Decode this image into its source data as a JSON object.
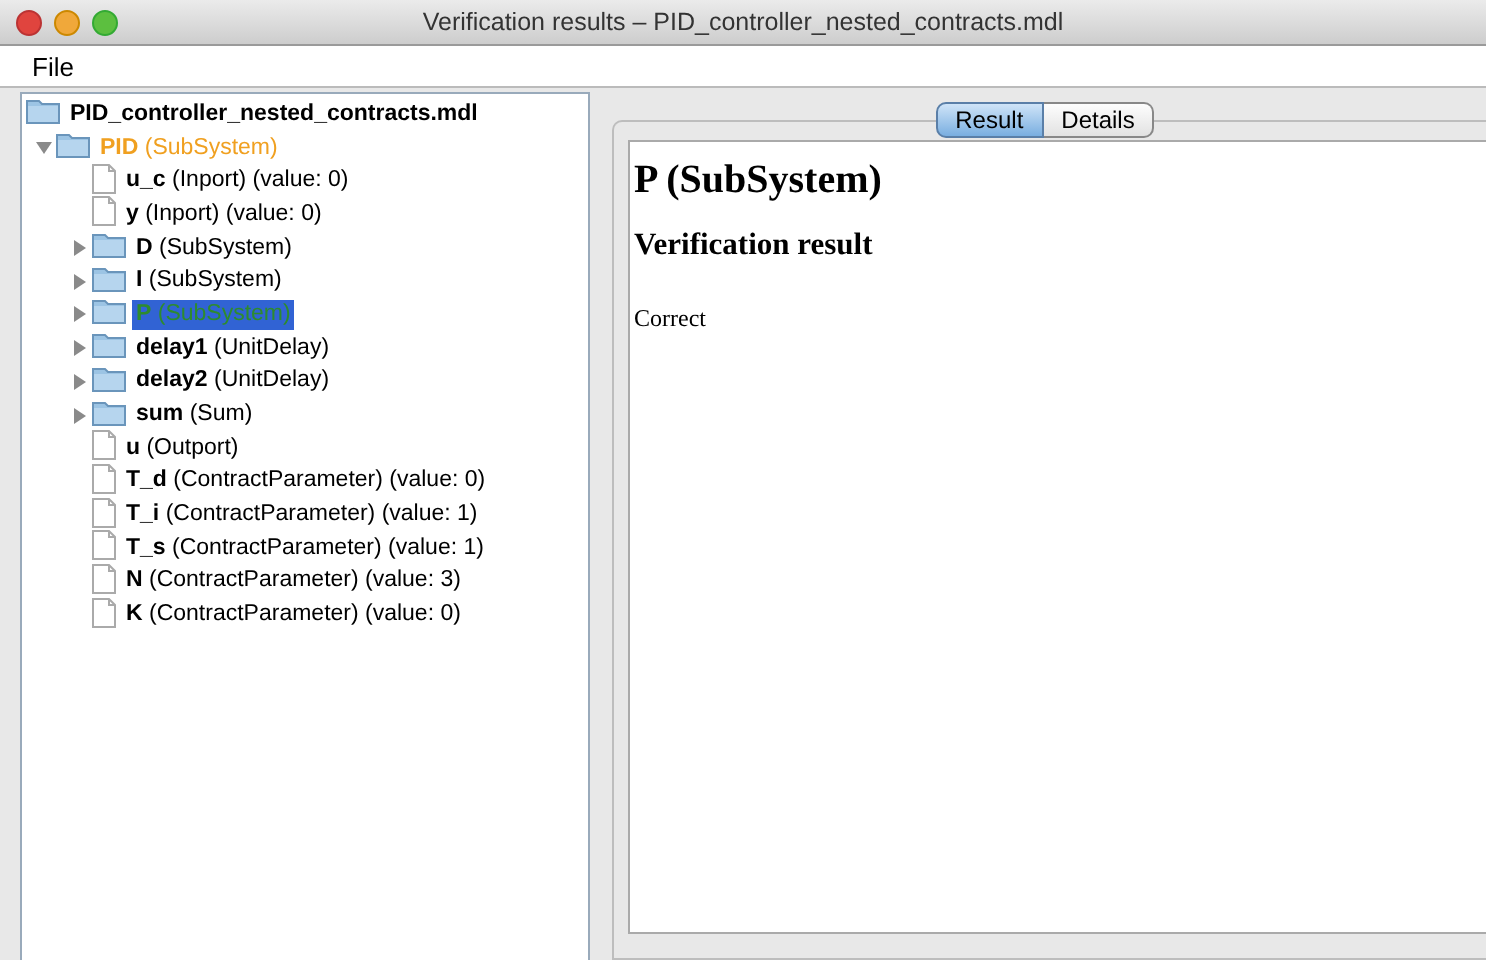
{
  "window": {
    "title": "Verification results – PID_controller_nested_contracts.mdl"
  },
  "menu": [
    "File"
  ],
  "tree": {
    "label": "PID_controller_nested_contracts.mdl",
    "kind": "folder",
    "selected": false,
    "color": "#000000",
    "children": [
      {
        "label": "**PID** (SubSystem)",
        "kind": "folder",
        "expanded": true,
        "selected": false,
        "color": "#f0a020",
        "children": [
          {
            "label": "**u_c** (Inport) (value: 0)",
            "kind": "file",
            "selected": false,
            "color": "#000000"
          },
          {
            "label": "**y** (Inport) (value: 0)",
            "kind": "file",
            "selected": false,
            "color": "#000000"
          },
          {
            "label": "**D** (SubSystem)",
            "kind": "folder",
            "expanded": false,
            "selected": false,
            "color": "#000000"
          },
          {
            "label": "**I** (SubSystem)",
            "kind": "folder",
            "expanded": false,
            "selected": false,
            "color": "#000000"
          },
          {
            "label": "**P** (SubSystem)",
            "kind": "folder",
            "expanded": false,
            "selected": true,
            "color": "#2e8b2e"
          },
          {
            "label": "**delay1** (UnitDelay)",
            "kind": "folder",
            "expanded": false,
            "selected": false,
            "color": "#000000"
          },
          {
            "label": "**delay2** (UnitDelay)",
            "kind": "folder",
            "expanded": false,
            "selected": false,
            "color": "#000000"
          },
          {
            "label": "**sum** (Sum)",
            "kind": "folder",
            "expanded": false,
            "selected": false,
            "color": "#000000"
          },
          {
            "label": "**u** (Outport)",
            "kind": "file",
            "selected": false,
            "color": "#000000"
          },
          {
            "label": "**T_d** (ContractParameter) (value: 0)",
            "kind": "file",
            "selected": false,
            "color": "#000000"
          },
          {
            "label": "**T_i** (ContractParameter) (value: 1)",
            "kind": "file",
            "selected": false,
            "color": "#000000"
          },
          {
            "label": "**T_s** (ContractParameter) (value: 1)",
            "kind": "file",
            "selected": false,
            "color": "#000000"
          },
          {
            "label": "**N** (ContractParameter) (value: 3)",
            "kind": "file",
            "selected": false,
            "color": "#000000"
          },
          {
            "label": "**K** (ContractParameter) (value: 0)",
            "kind": "file",
            "selected": false,
            "color": "#000000"
          }
        ]
      }
    ]
  },
  "tabs": [
    {
      "label": "Result",
      "selected": true
    },
    {
      "label": "Details",
      "selected": false
    }
  ],
  "result": {
    "heading": "P (SubSystem)",
    "subheading": "Verification result",
    "text": "Correct"
  }
}
